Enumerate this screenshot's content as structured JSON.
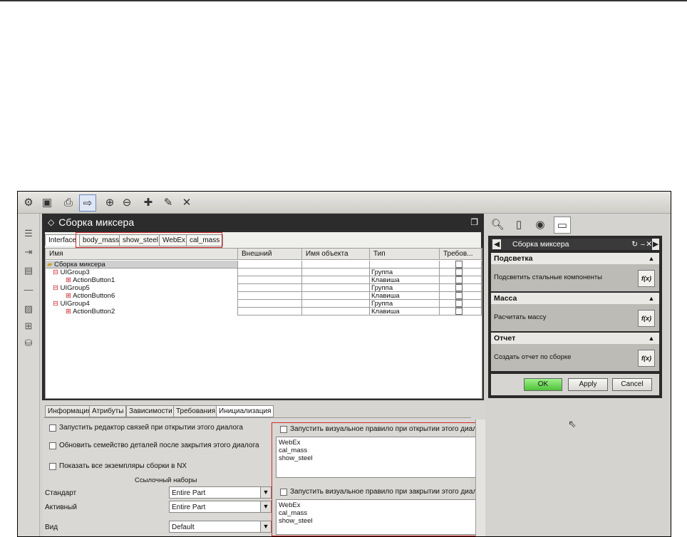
{
  "dialog": {
    "title": "Сборка миксера",
    "tabs": [
      "Interface",
      "body_mass",
      "show_steel",
      "WebEx",
      "cal_mass"
    ],
    "columns": [
      "Имя",
      "Внешний",
      "Имя объекта",
      "Тип",
      "Требов..."
    ],
    "rows": [
      {
        "name": "Сборка миксера",
        "type": ""
      },
      {
        "name": "UIGroup3",
        "type": "Группа"
      },
      {
        "name": "ActionButton1",
        "type": "Клавиша"
      },
      {
        "name": "UIGroup5",
        "type": "Группа"
      },
      {
        "name": "ActionButton6",
        "type": "Клавиша"
      },
      {
        "name": "UIGroup4",
        "type": "Группа"
      },
      {
        "name": "ActionButton2",
        "type": "Клавиша"
      }
    ]
  },
  "bottom": {
    "tabs": [
      "Информация",
      "Атрибуты",
      "Зависимости",
      "Требования",
      "Инициализация"
    ],
    "options": [
      "Запустить редактор связей при открытии этого диалога",
      "Обновить семейство деталей после закрытия этого диалога",
      "Показать все экземпляры сборки в NX"
    ],
    "refsets_label": "Ссылочный наборы",
    "fields": [
      {
        "label": "Стандарт",
        "value": "Entire Part"
      },
      {
        "label": "Активный",
        "value": "Entire Part"
      },
      {
        "label": "Вид",
        "value": "Default"
      }
    ],
    "open_rule_label": "Запустить визуальное правило при открытии этого диалога",
    "open_rule_items": [
      "WebEx",
      "cal_mass",
      "show_steel"
    ],
    "close_rule_label": "Запустить визуальное правило при закрытии этого диалога",
    "close_rule_items": [
      "WebEx",
      "cal_mass",
      "show_steel"
    ]
  },
  "panel": {
    "title": "Сборка миксера",
    "sections": [
      {
        "header": "Подсветка",
        "action": "Подсветить стальные компоненты",
        "fx": "f(x)"
      },
      {
        "header": "Масса",
        "action": "Расчитать массу",
        "fx": "f(x)"
      },
      {
        "header": "Отчет",
        "action": "Создать отчет по сборке",
        "fx": "f(x)"
      }
    ],
    "buttons": {
      "ok": "OK",
      "apply": "Apply",
      "cancel": "Cancel"
    }
  },
  "colors": {
    "highlight": "#d02828",
    "ok_button": "#6fd35b",
    "dialog_title_bg": "#2c2c2c"
  }
}
